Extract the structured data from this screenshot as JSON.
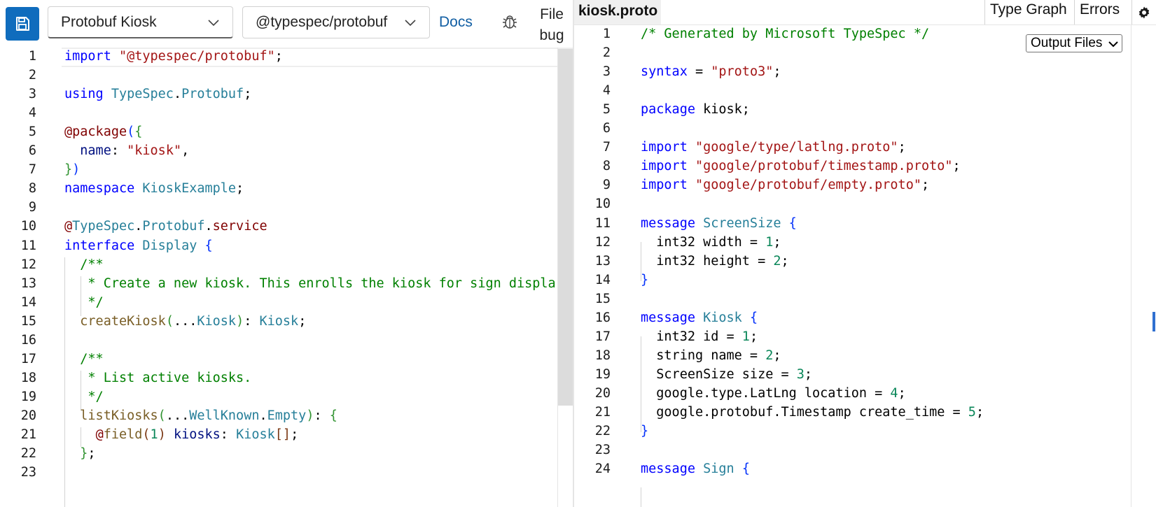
{
  "toolbar": {
    "sample_selected": "Protobuf Kiosk",
    "emitter_selected": "@typespec/protobuf",
    "docs_label": "Docs",
    "file_bug_label": "File bug"
  },
  "output_tabs": {
    "file_tab": "kiosk.proto",
    "type_graph": "Type Graph",
    "errors": "Errors",
    "output_files_select": "Output Files"
  },
  "left_editor": {
    "lines": [
      {
        "n": "1",
        "t": [
          [
            "kw",
            "import"
          ],
          [
            "pl",
            " "
          ],
          [
            "str",
            "\"@typespec/protobuf\""
          ],
          [
            "pl",
            ";"
          ]
        ]
      },
      {
        "n": "2",
        "t": []
      },
      {
        "n": "3",
        "t": [
          [
            "kw",
            "using"
          ],
          [
            "pl",
            " "
          ],
          [
            "ty",
            "TypeSpec"
          ],
          [
            "pl",
            "."
          ],
          [
            "ty",
            "Protobuf"
          ],
          [
            "pl",
            ";"
          ]
        ]
      },
      {
        "n": "4",
        "t": []
      },
      {
        "n": "5",
        "t": [
          [
            "dec",
            "@package"
          ],
          [
            "br1",
            "("
          ],
          [
            "br2",
            "{"
          ]
        ]
      },
      {
        "n": "6",
        "t": [
          [
            "pl",
            "  "
          ],
          [
            "var",
            "name"
          ],
          [
            "pl",
            ": "
          ],
          [
            "str",
            "\"kiosk\""
          ],
          [
            "pl",
            ","
          ]
        ]
      },
      {
        "n": "7",
        "t": [
          [
            "br2",
            "}"
          ],
          [
            "br1",
            ")"
          ]
        ]
      },
      {
        "n": "8",
        "t": [
          [
            "kw",
            "namespace"
          ],
          [
            "pl",
            " "
          ],
          [
            "ty",
            "KioskExample"
          ],
          [
            "pl",
            ";"
          ]
        ]
      },
      {
        "n": "9",
        "t": []
      },
      {
        "n": "10",
        "t": [
          [
            "dec",
            "@"
          ],
          [
            "ty",
            "TypeSpec"
          ],
          [
            "pl",
            "."
          ],
          [
            "ty",
            "Protobuf"
          ],
          [
            "pl",
            "."
          ],
          [
            "dec",
            "service"
          ]
        ]
      },
      {
        "n": "11",
        "t": [
          [
            "kw",
            "interface"
          ],
          [
            "pl",
            " "
          ],
          [
            "ty",
            "Display"
          ],
          [
            "pl",
            " "
          ],
          [
            "br1",
            "{"
          ]
        ]
      },
      {
        "n": "12",
        "t": [
          [
            "pl",
            "  "
          ],
          [
            "cm",
            "/**"
          ]
        ]
      },
      {
        "n": "13",
        "t": [
          [
            "pl",
            "  "
          ],
          [
            "cm",
            " * Create a new kiosk. This enrolls the kiosk for sign displa"
          ]
        ]
      },
      {
        "n": "14",
        "t": [
          [
            "pl",
            "  "
          ],
          [
            "cm",
            " */"
          ]
        ]
      },
      {
        "n": "15",
        "t": [
          [
            "pl",
            "  "
          ],
          [
            "fn",
            "createKiosk"
          ],
          [
            "br2",
            "("
          ],
          [
            "pl",
            "..."
          ],
          [
            "ty",
            "Kiosk"
          ],
          [
            "br2",
            ")"
          ],
          [
            "pl",
            ": "
          ],
          [
            "ty",
            "Kiosk"
          ],
          [
            "pl",
            ";"
          ]
        ]
      },
      {
        "n": "16",
        "t": []
      },
      {
        "n": "17",
        "t": [
          [
            "pl",
            "  "
          ],
          [
            "cm",
            "/**"
          ]
        ]
      },
      {
        "n": "18",
        "t": [
          [
            "pl",
            "  "
          ],
          [
            "cm",
            " * List active kiosks."
          ]
        ]
      },
      {
        "n": "19",
        "t": [
          [
            "pl",
            "  "
          ],
          [
            "cm",
            " */"
          ]
        ]
      },
      {
        "n": "20",
        "t": [
          [
            "pl",
            "  "
          ],
          [
            "fn",
            "listKiosks"
          ],
          [
            "br2",
            "("
          ],
          [
            "pl",
            "..."
          ],
          [
            "ty",
            "WellKnown"
          ],
          [
            "pl",
            "."
          ],
          [
            "ty",
            "Empty"
          ],
          [
            "br2",
            ")"
          ],
          [
            "pl",
            ": "
          ],
          [
            "br2",
            "{"
          ]
        ]
      },
      {
        "n": "21",
        "t": [
          [
            "pl",
            "    "
          ],
          [
            "dec",
            "@"
          ],
          [
            "fn",
            "field"
          ],
          [
            "br3",
            "("
          ],
          [
            "num",
            "1"
          ],
          [
            "br3",
            ")"
          ],
          [
            "pl",
            " "
          ],
          [
            "var",
            "kiosks"
          ],
          [
            "pl",
            ": "
          ],
          [
            "ty",
            "Kiosk"
          ],
          [
            "br3",
            "[]"
          ],
          [
            "pl",
            ";"
          ]
        ]
      },
      {
        "n": "22",
        "t": [
          [
            "pl",
            "  "
          ],
          [
            "br2",
            "}"
          ],
          [
            "pl",
            ";"
          ]
        ]
      },
      {
        "n": "23",
        "t": []
      }
    ]
  },
  "right_editor": {
    "lines": [
      {
        "n": "1",
        "t": [
          [
            "cm",
            "/* Generated by Microsoft TypeSpec */"
          ]
        ]
      },
      {
        "n": "2",
        "t": []
      },
      {
        "n": "3",
        "t": [
          [
            "kw",
            "syntax"
          ],
          [
            "pl",
            " = "
          ],
          [
            "str",
            "\"proto3\""
          ],
          [
            "pl",
            ";"
          ]
        ]
      },
      {
        "n": "4",
        "t": []
      },
      {
        "n": "5",
        "t": [
          [
            "kw",
            "package"
          ],
          [
            "pl",
            " kiosk;"
          ]
        ]
      },
      {
        "n": "6",
        "t": []
      },
      {
        "n": "7",
        "t": [
          [
            "kw",
            "import"
          ],
          [
            "pl",
            " "
          ],
          [
            "str",
            "\"google/type/latlng.proto\""
          ],
          [
            "pl",
            ";"
          ]
        ]
      },
      {
        "n": "8",
        "t": [
          [
            "kw",
            "import"
          ],
          [
            "pl",
            " "
          ],
          [
            "str",
            "\"google/protobuf/timestamp.proto\""
          ],
          [
            "pl",
            ";"
          ]
        ]
      },
      {
        "n": "9",
        "t": [
          [
            "kw",
            "import"
          ],
          [
            "pl",
            " "
          ],
          [
            "str",
            "\"google/protobuf/empty.proto\""
          ],
          [
            "pl",
            ";"
          ]
        ]
      },
      {
        "n": "10",
        "t": []
      },
      {
        "n": "11",
        "t": [
          [
            "kw",
            "message"
          ],
          [
            "pl",
            " "
          ],
          [
            "ty",
            "ScreenSize"
          ],
          [
            "pl",
            " "
          ],
          [
            "br1",
            "{"
          ]
        ]
      },
      {
        "n": "12",
        "t": [
          [
            "pl",
            "  int32 width = "
          ],
          [
            "num",
            "1"
          ],
          [
            "pl",
            ";"
          ]
        ]
      },
      {
        "n": "13",
        "t": [
          [
            "pl",
            "  int32 height = "
          ],
          [
            "num",
            "2"
          ],
          [
            "pl",
            ";"
          ]
        ]
      },
      {
        "n": "14",
        "t": [
          [
            "br1",
            "}"
          ]
        ]
      },
      {
        "n": "15",
        "t": []
      },
      {
        "n": "16",
        "t": [
          [
            "kw",
            "message"
          ],
          [
            "pl",
            " "
          ],
          [
            "ty",
            "Kiosk"
          ],
          [
            "pl",
            " "
          ],
          [
            "br1",
            "{"
          ]
        ]
      },
      {
        "n": "17",
        "t": [
          [
            "pl",
            "  int32 id = "
          ],
          [
            "num",
            "1"
          ],
          [
            "pl",
            ";"
          ]
        ]
      },
      {
        "n": "18",
        "t": [
          [
            "pl",
            "  string name = "
          ],
          [
            "num",
            "2"
          ],
          [
            "pl",
            ";"
          ]
        ]
      },
      {
        "n": "19",
        "t": [
          [
            "pl",
            "  ScreenSize size = "
          ],
          [
            "num",
            "3"
          ],
          [
            "pl",
            ";"
          ]
        ]
      },
      {
        "n": "20",
        "t": [
          [
            "pl",
            "  google.type.LatLng location = "
          ],
          [
            "num",
            "4"
          ],
          [
            "pl",
            ";"
          ]
        ]
      },
      {
        "n": "21",
        "t": [
          [
            "pl",
            "  google.protobuf.Timestamp create_time = "
          ],
          [
            "num",
            "5"
          ],
          [
            "pl",
            ";"
          ]
        ]
      },
      {
        "n": "22",
        "t": [
          [
            "br1",
            "}"
          ]
        ]
      },
      {
        "n": "23",
        "t": []
      },
      {
        "n": "24",
        "t": [
          [
            "kw",
            "message"
          ],
          [
            "pl",
            " "
          ],
          [
            "ty",
            "Sign"
          ],
          [
            "pl",
            " "
          ],
          [
            "br1",
            "{"
          ]
        ]
      }
    ]
  },
  "icons": {
    "save": "save-icon",
    "bug": "bug-icon",
    "settings": "gear-icon",
    "chevron": "chevron-down-icon"
  },
  "colors": {
    "accent": "#0f6cbd",
    "keyword": "#0000ff",
    "string": "#a31515",
    "type": "#267f99",
    "comment": "#008000",
    "number": "#098658"
  }
}
